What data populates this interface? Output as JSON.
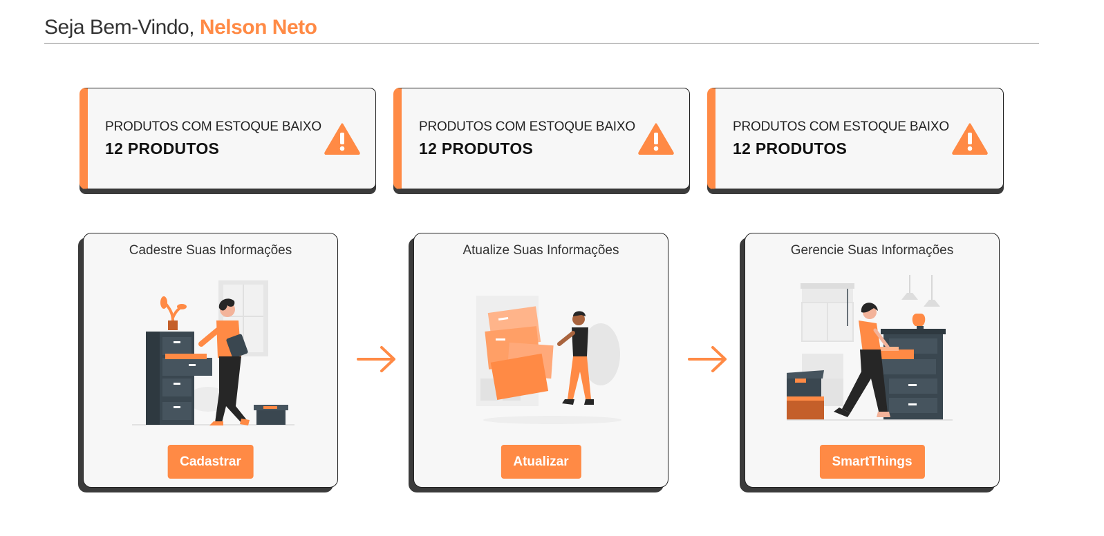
{
  "header": {
    "greeting": "Seja Bem-Vindo,",
    "user_name": "Nelson Neto"
  },
  "stats": [
    {
      "label": "PRODUTOS COM ESTOQUE BAIXO",
      "value": "12 PRODUTOS",
      "icon": "warning-icon"
    },
    {
      "label": "PRODUTOS COM ESTOQUE BAIXO",
      "value": "12 PRODUTOS",
      "icon": "warning-icon"
    },
    {
      "label": "PRODUTOS COM ESTOQUE BAIXO",
      "value": "12 PRODUTOS",
      "icon": "warning-icon"
    }
  ],
  "actions": [
    {
      "title": "Cadestre Suas Informações",
      "button": "Cadastrar",
      "illustration": "filing-cabinet-illustration"
    },
    {
      "title": "Atualize Suas Informações",
      "button": "Atualizar",
      "illustration": "folders-illustration"
    },
    {
      "title": "Gerencie Suas Informações",
      "button": "SmartThings",
      "illustration": "drawer-illustration"
    }
  ],
  "colors": {
    "accent": "#ff8a45",
    "card_bg": "#f7f7f7",
    "shadow": "#3b3b3b",
    "dark": "#3a4750"
  }
}
